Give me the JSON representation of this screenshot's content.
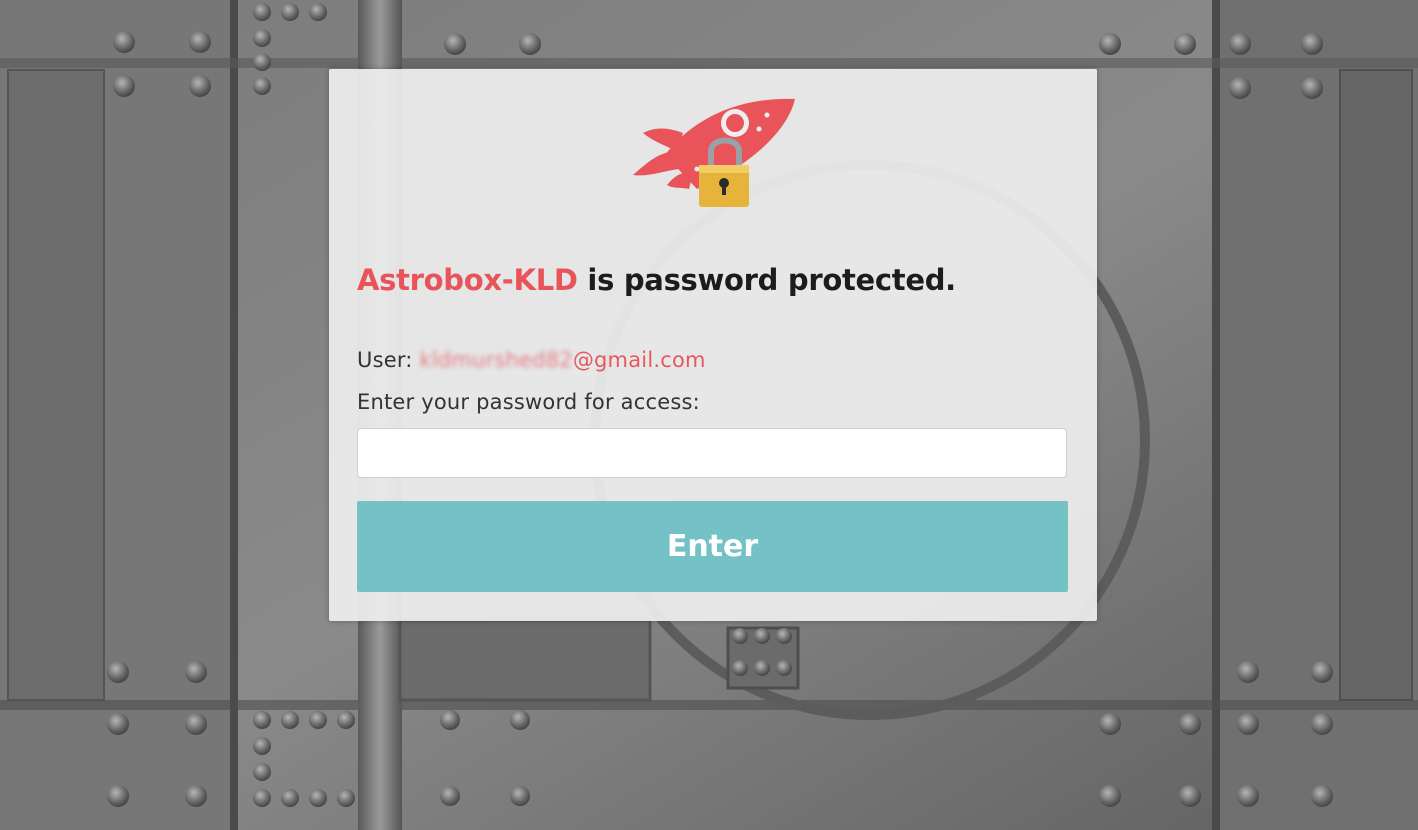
{
  "app": {
    "name": "Astrobox-KLD",
    "protected_suffix": " is password protected."
  },
  "user": {
    "label": "User:",
    "email_obscured": "kldmurshed82",
    "email_domain": "@gmail.com"
  },
  "password": {
    "prompt": "Enter your password for access:",
    "value": "",
    "placeholder": ""
  },
  "enter_button": {
    "label": "Enter"
  },
  "colors": {
    "brand_red": "#e8545a",
    "button_teal": "#74c2c6",
    "card_bg": "#eeeeee",
    "lock_gold": "#e6b43a"
  },
  "icons": {
    "logo": "rocket-lock-icon"
  }
}
